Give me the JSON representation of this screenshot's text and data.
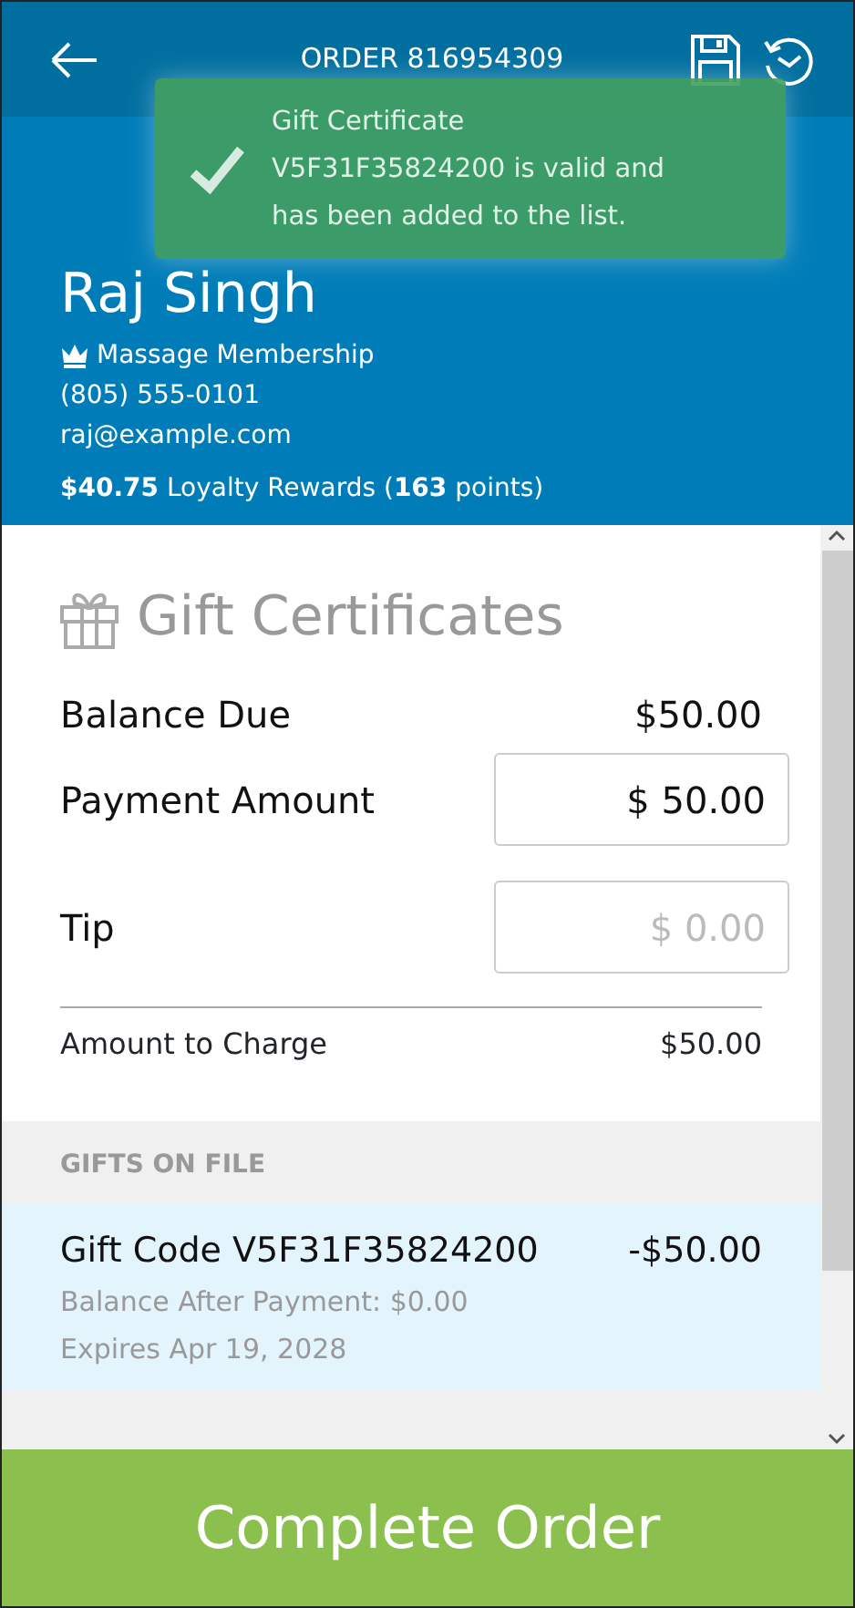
{
  "header": {
    "title": "ORDER 816954309"
  },
  "toast": {
    "message": "Gift Certificate V5F31F35824200 is valid and has been added to the list."
  },
  "customer": {
    "name": "Raj Singh",
    "membership": "Massage Membership",
    "phone": "(805) 555-0101",
    "email": "raj@example.com",
    "rewards": "**$40.75** Loyalty Rewards (**163** points)"
  },
  "section": {
    "title": "Gift Certificates"
  },
  "summary": {
    "balance_label": "Balance Due",
    "balance_value": "$50.00",
    "payment_label": "Payment Amount",
    "payment_value": "$ 50.00",
    "tip_label": "Tip",
    "tip_placeholder": "$ 0.00",
    "charge_label": "Amount to Charge",
    "charge_value": "$50.00"
  },
  "gifts": {
    "heading": "GIFTS ON FILE",
    "items": [
      {
        "code": "Gift Code V5F31F35824200",
        "amount": "-$50.00",
        "balance": "Balance After Payment: $0.00",
        "expires": "Expires Apr 19, 2028"
      }
    ]
  },
  "complete_button": "Complete Order"
}
